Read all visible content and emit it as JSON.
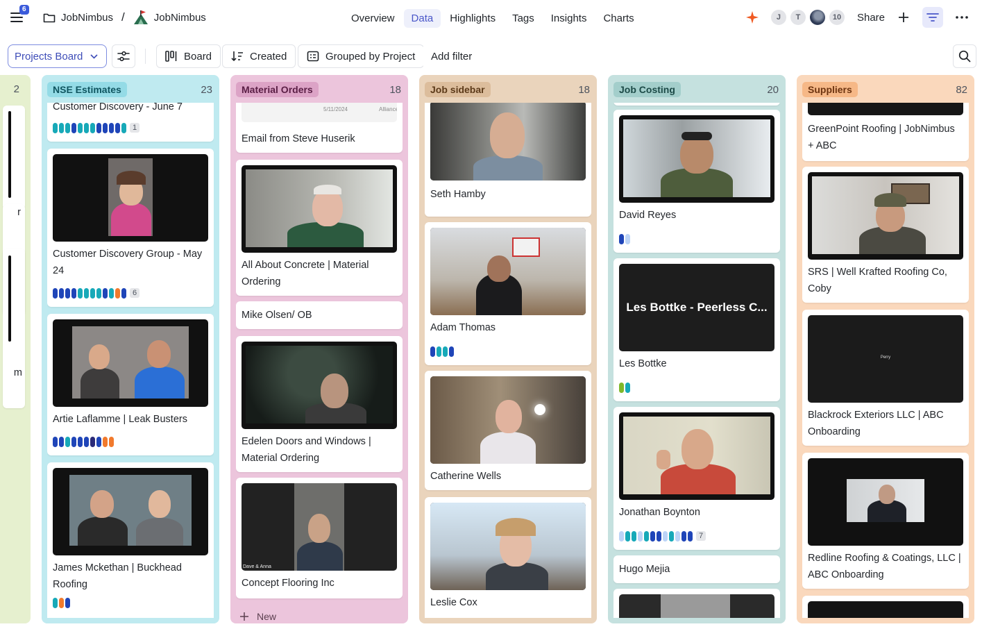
{
  "topbar": {
    "menu_badge": "6",
    "workspace": "JobNimbus",
    "separator": "/",
    "project": "JobNimbus",
    "tabs": [
      {
        "label": "Overview",
        "active": false
      },
      {
        "label": "Data",
        "active": true
      },
      {
        "label": "Highlights",
        "active": false
      },
      {
        "label": "Tags",
        "active": false
      },
      {
        "label": "Insights",
        "active": false
      },
      {
        "label": "Charts",
        "active": false
      }
    ],
    "avatars": [
      "J",
      "T"
    ],
    "viewer_count": "10",
    "share_label": "Share"
  },
  "toolbar": {
    "board_select": "Projects Board",
    "board_view": "Board",
    "sort": "Created",
    "group": "Grouped by Project",
    "add_filter": "Add filter"
  },
  "colors": {
    "accent": "#4a57c9",
    "pill_dark": "#1f45b8",
    "pill_teal": "#17a9b8",
    "pill_light": "#bcd4f7",
    "pill_orange": "#f17a2d",
    "pill_navy": "#2a2a78",
    "pill_green": "#7fb82a"
  },
  "columns": [
    {
      "id": "partial",
      "title": "",
      "count": "2",
      "cards": [
        {
          "title": "r"
        },
        {
          "title": "m"
        }
      ]
    },
    {
      "id": "nse",
      "title": "NSE Estimates",
      "count": "23",
      "cards": [
        {
          "title": "Customer Discovery - June 7",
          "pill_count": "1"
        },
        {
          "title": "Customer Discovery Group - May 24",
          "pill_count": "6"
        },
        {
          "title": "Artie Laflamme | Leak Busters"
        },
        {
          "title": "James Mckethan | Buckhead Roofing"
        }
      ]
    },
    {
      "id": "material",
      "title": "Material Orders",
      "count": "18",
      "cards": [
        {
          "title": "Email from Steve Huserik",
          "thumb_date": "5/11/2024",
          "thumb_note": "Alliance"
        },
        {
          "title": "All About Concrete | Material Ordering"
        },
        {
          "title": "Mike Olsen/ OB"
        },
        {
          "title": "Edelen Doors and Windows | Material Ordering"
        },
        {
          "title": "Concept Flooring Inc",
          "thumb_label": "Dave & Anna"
        }
      ],
      "new_label": "New"
    },
    {
      "id": "jobsidebar",
      "title": "Job sidebar",
      "count": "18",
      "cards": [
        {
          "title": "Seth Hamby"
        },
        {
          "title": "Adam Thomas"
        },
        {
          "title": "Catherine Wells"
        },
        {
          "title": "Leslie Cox"
        }
      ]
    },
    {
      "id": "jobcosting",
      "title": "Job Costing",
      "count": "20",
      "cards": [
        {
          "title": "David Reyes"
        },
        {
          "title": "Les Bottke",
          "thumb_text": "Les Bottke - Peerless C..."
        },
        {
          "title": "Jonathan Boynton",
          "pill_count": "7"
        },
        {
          "title": "Hugo Mejia"
        }
      ]
    },
    {
      "id": "suppliers",
      "title": "Suppliers",
      "count": "82",
      "cards": [
        {
          "title": "GreenPoint Roofing | JobNimbus + ABC"
        },
        {
          "title": "SRS | Well Krafted Roofing Co, Coby"
        },
        {
          "title": "Blackrock Exteriors LLC | ABC Onboarding",
          "thumb_text": "Perry"
        },
        {
          "title": "Redline Roofing & Coatings, LLC | ABC Onboarding"
        }
      ]
    }
  ]
}
